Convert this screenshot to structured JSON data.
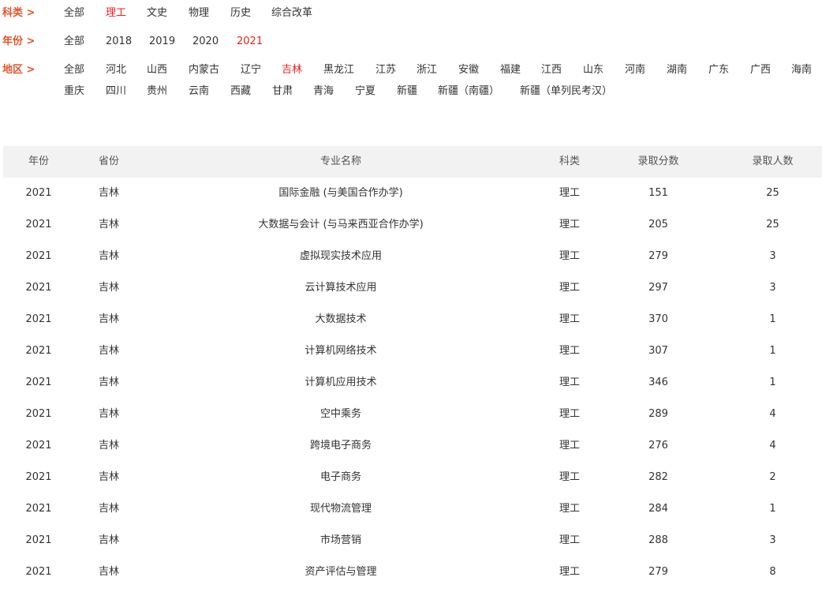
{
  "filters": {
    "category": {
      "label": "科类 >",
      "options": [
        "全部",
        "理工",
        "文史",
        "物理",
        "历史",
        "综合改革"
      ],
      "selected": "理工"
    },
    "year": {
      "label": "年份 >",
      "options": [
        "全部",
        "2018",
        "2019",
        "2020",
        "2021"
      ],
      "selected": "2021"
    },
    "region": {
      "label": "地区 >",
      "row1": [
        "全部",
        "河北",
        "山西",
        "内蒙古",
        "辽宁",
        "吉林",
        "黑龙江",
        "江苏",
        "浙江",
        "安徽",
        "福建",
        "江西",
        "山东",
        "河南",
        "湖南",
        "广东",
        "广西",
        "海南"
      ],
      "row2": [
        "重庆",
        "四川",
        "贵州",
        "云南",
        "西藏",
        "甘肃",
        "青海",
        "宁夏",
        "新疆",
        "新疆（南疆）",
        "新疆（单列民考汉）"
      ],
      "selected": "吉林"
    }
  },
  "table": {
    "headers": [
      "年份",
      "省份",
      "专业名称",
      "科类",
      "录取分数",
      "录取人数"
    ],
    "rows": [
      [
        "2021",
        "吉林",
        "国际金融 (与美国合作办学)",
        "理工",
        "151",
        "25"
      ],
      [
        "2021",
        "吉林",
        "大数据与会计 (与马来西亚合作办学)",
        "理工",
        "205",
        "25"
      ],
      [
        "2021",
        "吉林",
        "虚拟现实技术应用",
        "理工",
        "279",
        "3"
      ],
      [
        "2021",
        "吉林",
        "云计算技术应用",
        "理工",
        "297",
        "3"
      ],
      [
        "2021",
        "吉林",
        "大数据技术",
        "理工",
        "370",
        "1"
      ],
      [
        "2021",
        "吉林",
        "计算机网络技术",
        "理工",
        "307",
        "1"
      ],
      [
        "2021",
        "吉林",
        "计算机应用技术",
        "理工",
        "346",
        "1"
      ],
      [
        "2021",
        "吉林",
        "空中乘务",
        "理工",
        "289",
        "4"
      ],
      [
        "2021",
        "吉林",
        "跨境电子商务",
        "理工",
        "276",
        "4"
      ],
      [
        "2021",
        "吉林",
        "电子商务",
        "理工",
        "282",
        "2"
      ],
      [
        "2021",
        "吉林",
        "现代物流管理",
        "理工",
        "284",
        "1"
      ],
      [
        "2021",
        "吉林",
        "市场营销",
        "理工",
        "288",
        "3"
      ],
      [
        "2021",
        "吉林",
        "资产评估与管理",
        "理工",
        "279",
        "8"
      ]
    ]
  },
  "colors": {
    "label": "#e8552b",
    "active": "#e8211d",
    "header_bg": "#f2f2f2"
  }
}
